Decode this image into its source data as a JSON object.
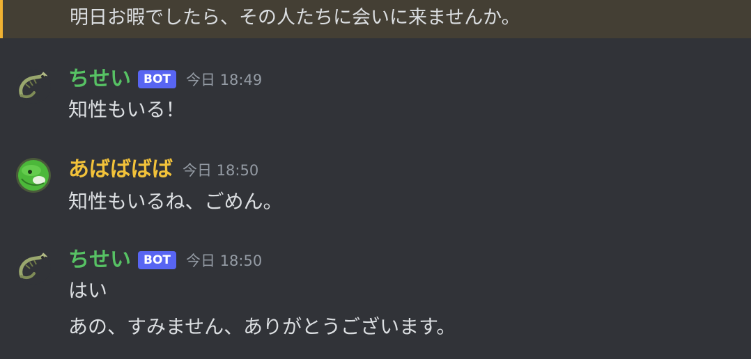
{
  "highlighted_message": {
    "text": "明日お暇でしたら、その人たちに会いに来ませんか。",
    "accent_color": "#f0b232"
  },
  "messages": [
    {
      "author": "ちせい",
      "author_color": "#57c264",
      "bot_tag": "BOT",
      "timestamp": "今日 18:49",
      "avatar_icon": "shrimp-icon",
      "lines": [
        "知性もいる！"
      ]
    },
    {
      "author": "あばばばば",
      "author_color": "#f2c23a",
      "timestamp": "今日 18:50",
      "avatar_icon": "green-ball-avatar-icon",
      "lines": [
        "知性もいるね、ごめん。"
      ]
    },
    {
      "author": "ちせい",
      "author_color": "#57c264",
      "bot_tag": "BOT",
      "timestamp": "今日 18:50",
      "avatar_icon": "shrimp-icon",
      "lines": [
        "はい",
        "あの、すみません、ありがとうございます。"
      ]
    }
  ]
}
